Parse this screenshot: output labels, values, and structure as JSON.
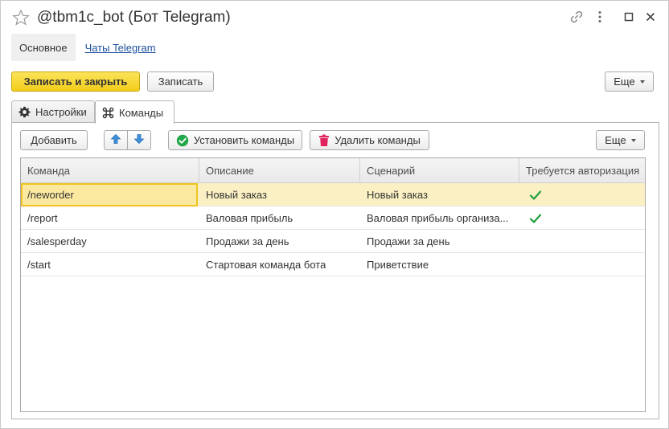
{
  "window": {
    "title": "@tbm1c_bot (Бот Telegram)"
  },
  "sections": {
    "active_label": "Основное",
    "link_label": "Чаты Telegram"
  },
  "toolbar": {
    "save_close_label": "Записать и закрыть",
    "save_label": "Записать",
    "more_label": "Еще"
  },
  "tabs": [
    {
      "label": "Настройки",
      "icon": "gear-icon"
    },
    {
      "label": "Команды",
      "icon": "command-icon"
    }
  ],
  "commands_toolbar": {
    "add_label": "Добавить",
    "set_commands_label": "Установить команды",
    "delete_commands_label": "Удалить команды",
    "more_label": "Еще"
  },
  "table": {
    "columns": [
      "Команда",
      "Описание",
      "Сценарий",
      "Требуется авторизация"
    ],
    "rows": [
      {
        "command": "/neworder",
        "description": "Новый заказ",
        "scenario": "Новый заказ",
        "auth_required": true
      },
      {
        "command": "/report",
        "description": "Валовая прибыль",
        "scenario": "Валовая прибыль организа...",
        "auth_required": true
      },
      {
        "command": "/salesperday",
        "description": "Продажи за день",
        "scenario": "Продажи за день",
        "auth_required": false
      },
      {
        "command": "/start",
        "description": "Стартовая команда бота",
        "scenario": "Приветствие",
        "auth_required": false
      }
    ]
  },
  "colors": {
    "primary_button": "#f5d52a",
    "selected_row": "#fbf0c3",
    "focused_cell_border": "#f0c420",
    "check_green": "#1e9e3a",
    "link": "#1b4f9c"
  }
}
